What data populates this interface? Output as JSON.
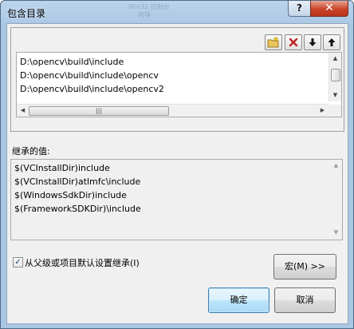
{
  "window": {
    "title": "包含目录",
    "help_glyph": "?",
    "close_glyph": "✕",
    "ghost_text_1": "Win32 控制台",
    "ghost_text_2": "向导"
  },
  "toolbar": {
    "new_line_icon": "folder-new-icon",
    "delete_icon": "delete-x-icon",
    "move_down_icon": "arrow-down-icon",
    "move_up_icon": "arrow-up-icon",
    "delete_color": "#c02020"
  },
  "include_dirs": [
    "D:\\opencv\\build\\include",
    "D:\\opencv\\build\\include\\opencv",
    "D:\\opencv\\build\\include\\opencv2"
  ],
  "inherited": {
    "label": "继承的值:",
    "values": [
      "$(VCInstallDir)include",
      "$(VCInstallDir)atlmfc\\include",
      "$(WindowsSdkDir)include",
      "$(FrameworkSDKDir)\\include"
    ]
  },
  "inherit_checkbox": {
    "label": "从父级或项目默认设置继承(I)",
    "checked": true,
    "mark": "✓"
  },
  "buttons": {
    "macros": "宏(M) >>",
    "ok": "确定",
    "cancel": "取消"
  },
  "scrollbar": {
    "up": "▲",
    "down": "▼",
    "left": "◀",
    "right": "▶",
    "grip": "|||"
  }
}
